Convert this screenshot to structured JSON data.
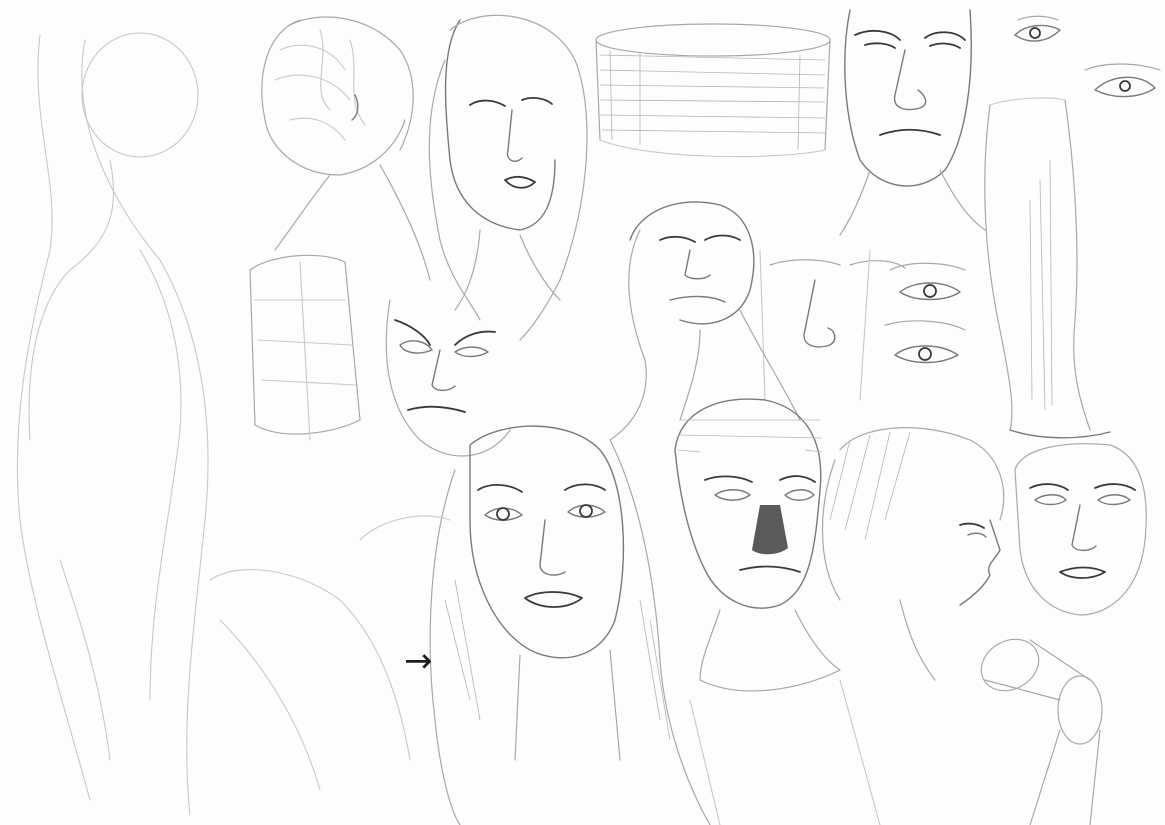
{
  "image": {
    "type": "pencil-sketch-sheet",
    "paper_color": "#fdfdfd",
    "pencil_color": "#3a3a3a",
    "subjects": [
      "standing-figure-outline",
      "woman-hair-bun-back-view",
      "woman-head-looking-up",
      "cylinder-study",
      "man-head-front-top-center",
      "eye-studies-top-right",
      "leg-study-right",
      "man-head-looking-up",
      "nose-study",
      "eye-pair-studies",
      "box-torso-study",
      "angry-face-study",
      "woman-long-hair-portrait",
      "man-short-hair-portrait",
      "boy-profile",
      "woman-face-right",
      "limb-cylinder-study"
    ],
    "arrow": {
      "glyph": "→",
      "icon": "right-arrow-icon"
    }
  }
}
